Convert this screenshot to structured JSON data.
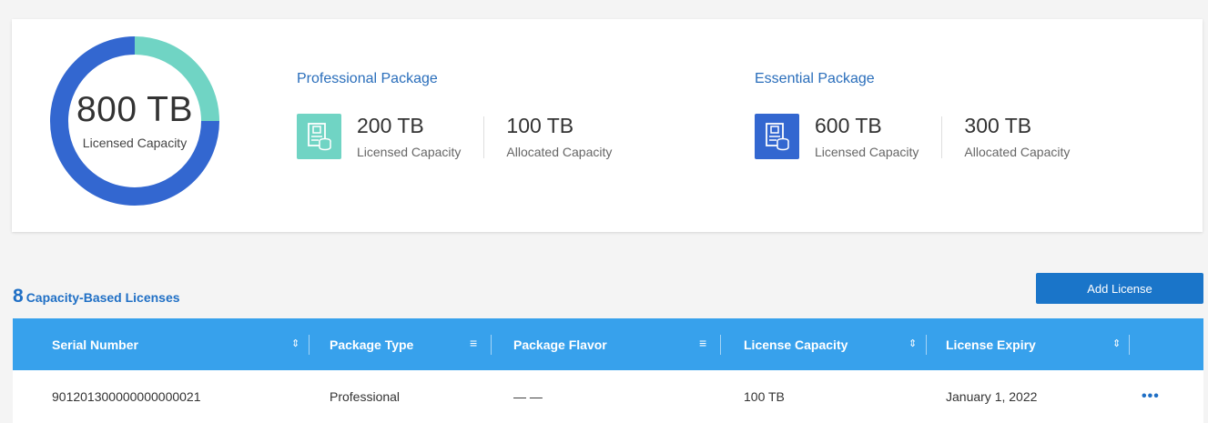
{
  "summary": {
    "total_value": "800 TB",
    "total_label": "Licensed Capacity",
    "donut_fractions": {
      "professional": 0.25,
      "essential": 0.75
    },
    "colors": {
      "professional": "#70d4c4",
      "essential": "#3367d0"
    }
  },
  "professional": {
    "title": "Professional Package",
    "icon": "license-document-icon",
    "icon_color": "#70d4c4",
    "licensed_value": "200 TB",
    "licensed_label": "Licensed Capacity",
    "allocated_value": "100 TB",
    "allocated_label": "Allocated Capacity"
  },
  "essential": {
    "title": "Essential Package",
    "icon": "license-document-icon",
    "icon_color": "#3367d0",
    "licensed_value": "600 TB",
    "licensed_label": "Licensed Capacity",
    "allocated_value": "300 TB",
    "allocated_label": "Allocated Capacity"
  },
  "licenses": {
    "count": "8",
    "heading": "Capacity-Based Licenses",
    "add_label": "Add License"
  },
  "table": {
    "columns": [
      {
        "label": "Serial Number",
        "icon": "sort-icon"
      },
      {
        "label": "Package Type",
        "icon": "filter-icon"
      },
      {
        "label": "Package Flavor",
        "icon": "filter-icon"
      },
      {
        "label": "License Capacity",
        "icon": "sort-icon"
      },
      {
        "label": "License Expiry",
        "icon": "sort-icon"
      }
    ],
    "rows": [
      {
        "serial": "901201300000000000021",
        "type": "Professional",
        "flavor": "— —",
        "capacity": "100 TB",
        "expiry": "January 1, 2022",
        "menu": "•••"
      }
    ]
  }
}
